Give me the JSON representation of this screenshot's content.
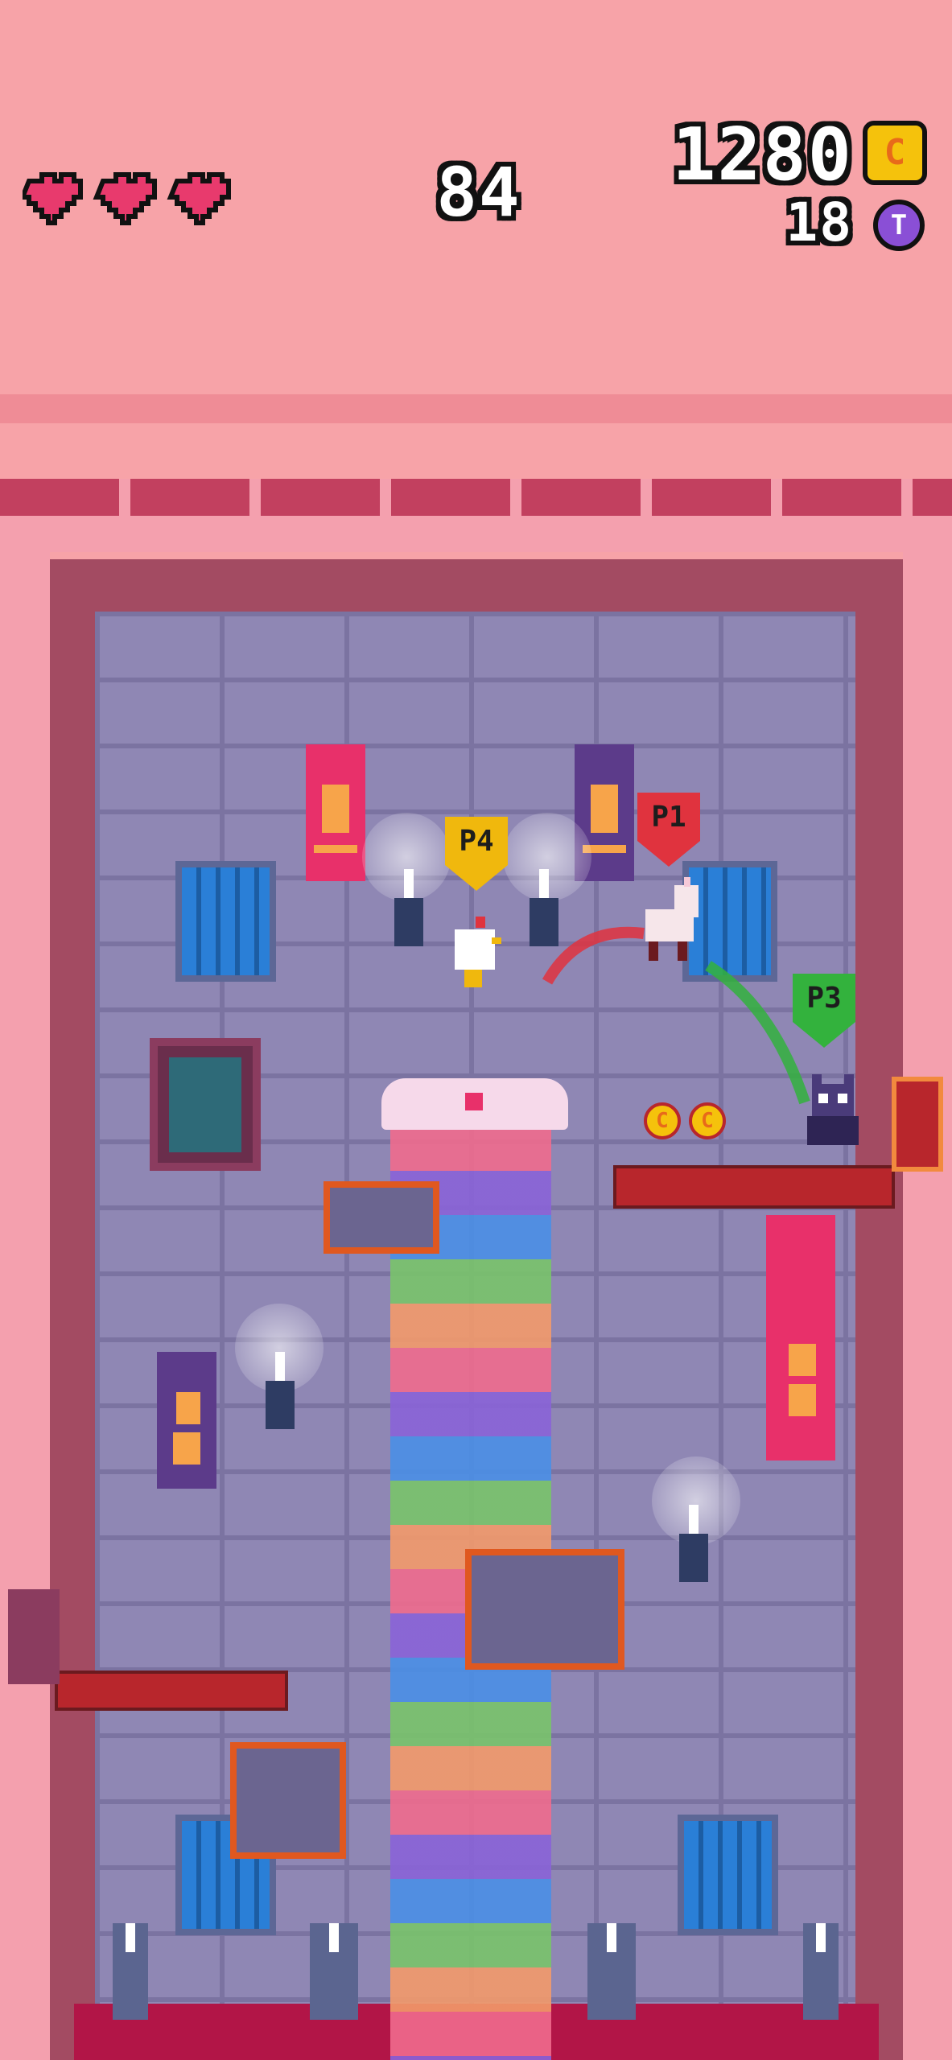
{
  "hud": {
    "lives": 3,
    "level": "84",
    "coins": "1280",
    "tokens": "18",
    "coin_icon_letter": "C",
    "token_icon_letter": "T"
  },
  "players": [
    {
      "tag": "P1",
      "color": "#e0333e",
      "character": "pony"
    },
    {
      "tag": "P3",
      "color": "#33b23d",
      "character": "cat"
    },
    {
      "tag": "P4",
      "color": "#f0b80d",
      "character": "chicken"
    }
  ],
  "coin_pickups": [
    {
      "letter": "C"
    },
    {
      "letter": "C"
    }
  ],
  "colors": {
    "sky": "#f7a3a8",
    "frame": "#a34b62",
    "wall": "#8f87b4",
    "heart": "#e83a6d",
    "coin": "#f5c20c",
    "token": "#8a4fd6"
  }
}
